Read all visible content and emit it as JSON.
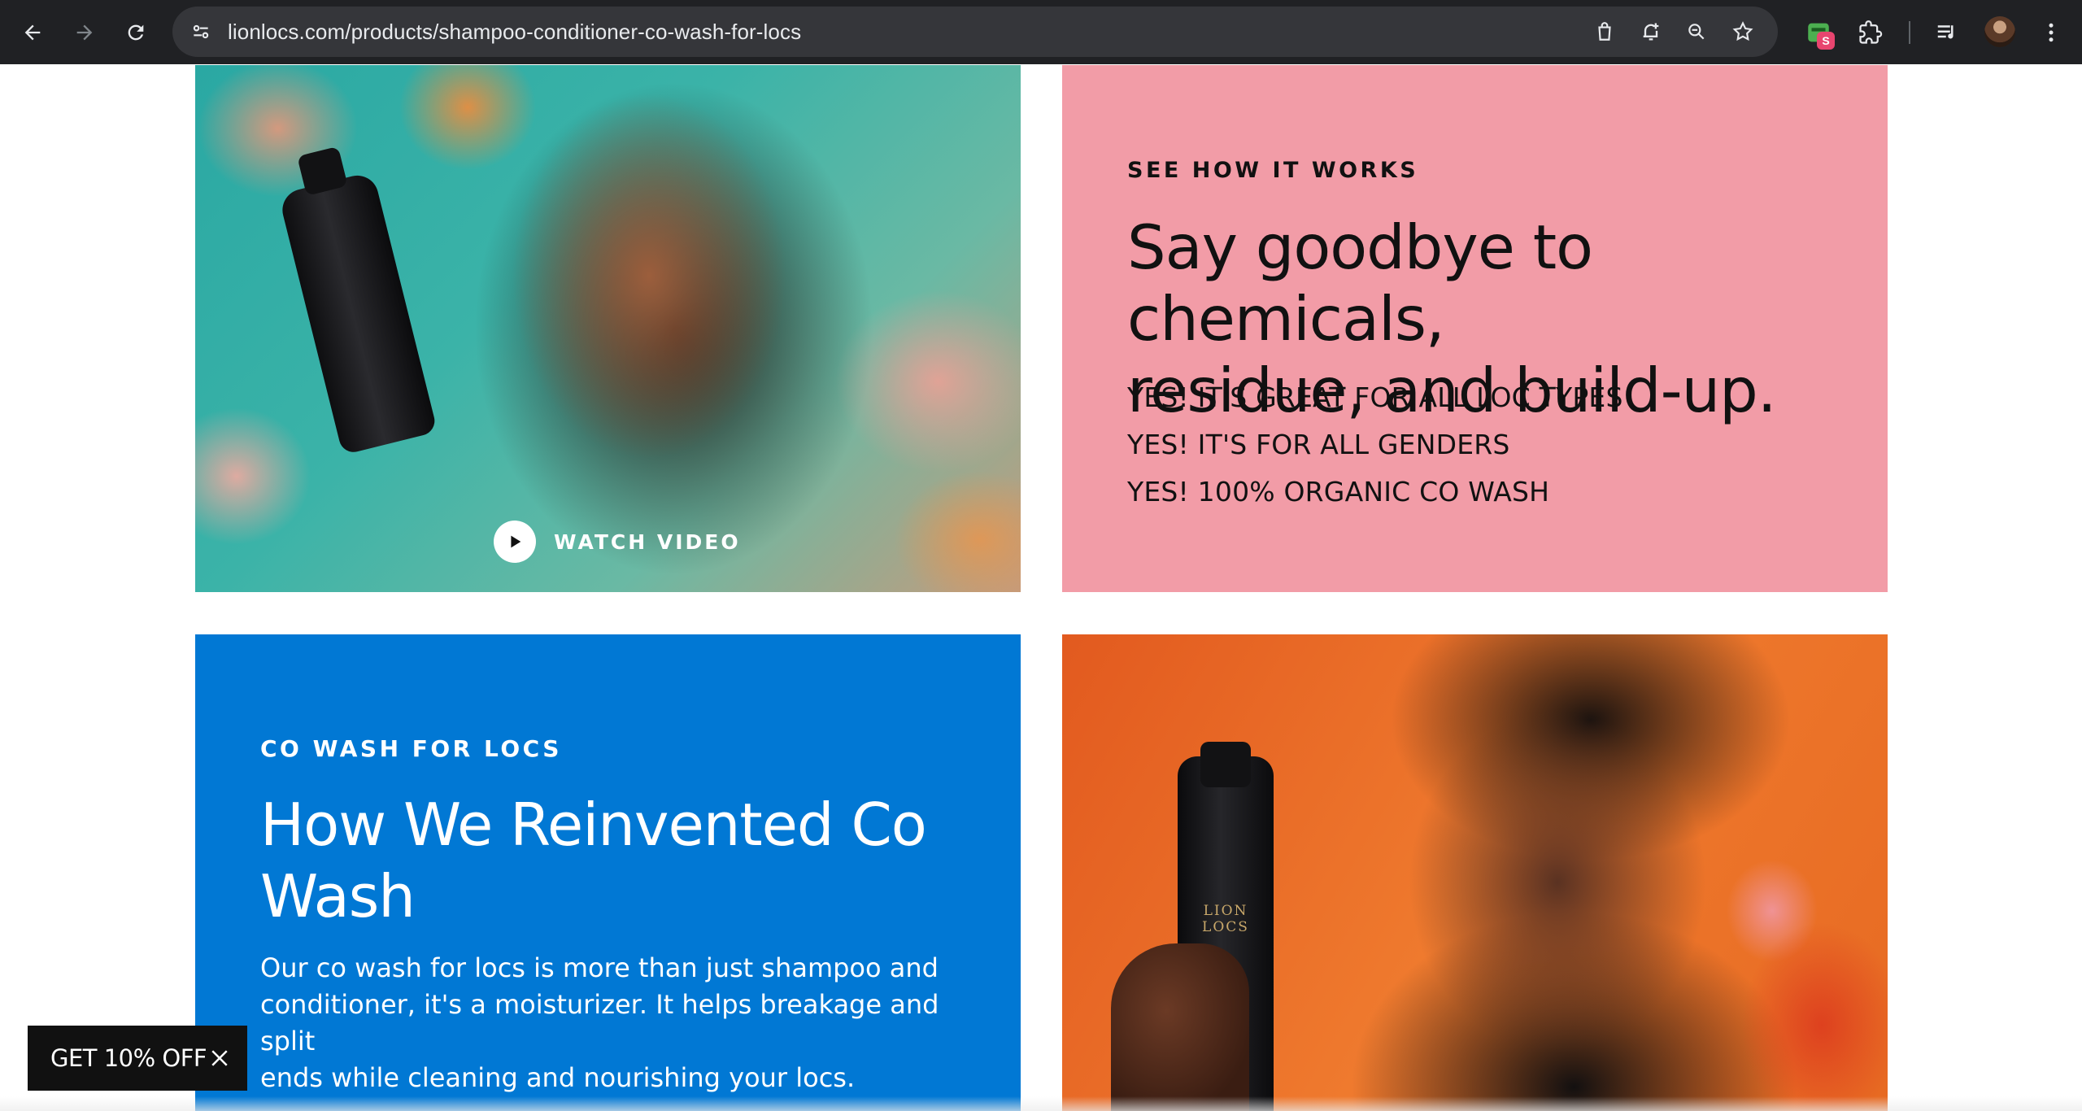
{
  "browser": {
    "url": "lionlocs.com/products/shampoo-conditioner-co-wash-for-locs",
    "extension_badge": "S"
  },
  "cards": {
    "video": {
      "watch_label": "WATCH VIDEO",
      "image_description": "woman with locs smiling holding black shampoo bottle among flowers"
    },
    "how_it_works": {
      "eyebrow": "SEE HOW IT WORKS",
      "headline_line1": "Say goodbye to chemicals,",
      "headline_line2": "residue, and build-up.",
      "bullets": [
        "YES! IT'S GREAT FOR ALL LOC TYPES",
        "YES! IT'S FOR ALL GENDERS",
        "YES! 100% ORGANIC CO WASH"
      ],
      "background_color": "#f29ca7"
    },
    "co_wash": {
      "eyebrow": "CO WASH FOR LOCS",
      "headline_line1": "How We Reinvented Co",
      "headline_line2": "Wash",
      "body_line1": "Our co wash for locs is more than just shampoo and",
      "body_line2": "conditioner, it's a moisturizer. It helps breakage and split",
      "body_line3": "ends while cleaning and nourishing your locs.",
      "background_color": "#0178d4"
    },
    "product_photo": {
      "bottle_label": "LION LOCS"
    }
  },
  "promo": {
    "label": "GET 10% OFF"
  }
}
